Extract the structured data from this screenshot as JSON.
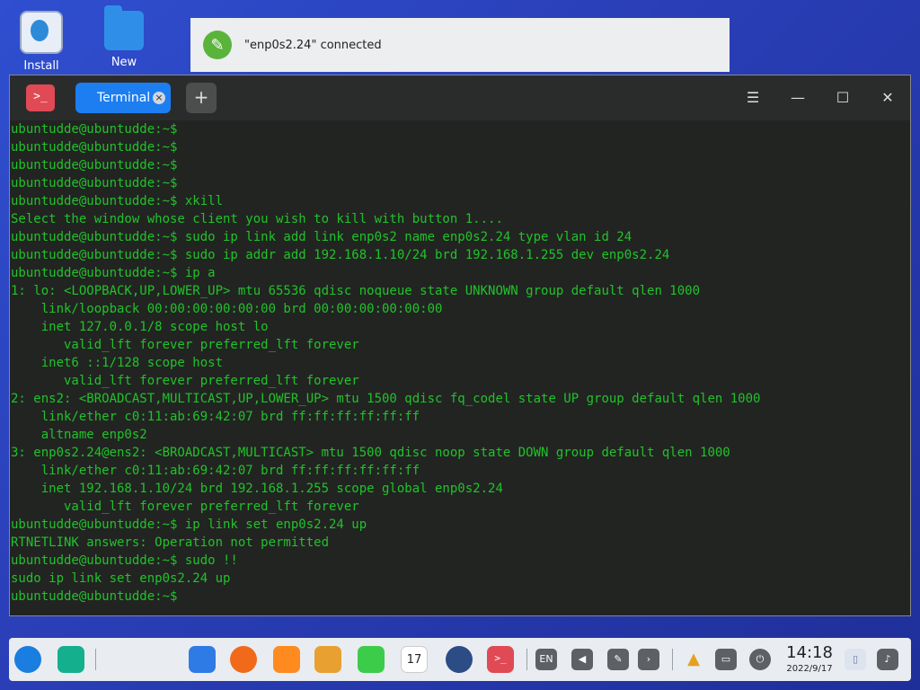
{
  "desktop": {
    "icons": [
      {
        "label": "Install"
      },
      {
        "label": "New"
      }
    ]
  },
  "notification": {
    "text": "\"enp0s2.24\" connected"
  },
  "window": {
    "app_icon": ">_",
    "tab_label": "Terminal",
    "tab_close": "×",
    "new_tab": "+",
    "menu": "☰",
    "minimize": "—",
    "maximize": "☐",
    "close": "✕"
  },
  "terminal": {
    "lines": [
      "ubuntudde@ubuntudde:~$",
      "ubuntudde@ubuntudde:~$",
      "ubuntudde@ubuntudde:~$",
      "ubuntudde@ubuntudde:~$",
      "ubuntudde@ubuntudde:~$ xkill",
      "Select the window whose client you wish to kill with button 1....",
      "ubuntudde@ubuntudde:~$ sudo ip link add link enp0s2 name enp0s2.24 type vlan id 24",
      "ubuntudde@ubuntudde:~$ sudo ip addr add 192.168.1.10/24 brd 192.168.1.255 dev enp0s2.24",
      "ubuntudde@ubuntudde:~$ ip a",
      "1: lo: <LOOPBACK,UP,LOWER_UP> mtu 65536 qdisc noqueue state UNKNOWN group default qlen 1000",
      "    link/loopback 00:00:00:00:00:00 brd 00:00:00:00:00:00",
      "    inet 127.0.0.1/8 scope host lo",
      "       valid_lft forever preferred_lft forever",
      "    inet6 ::1/128 scope host",
      "       valid_lft forever preferred_lft forever",
      "2: ens2: <BROADCAST,MULTICAST,UP,LOWER_UP> mtu 1500 qdisc fq_codel state UP group default qlen 1000",
      "    link/ether c0:11:ab:69:42:07 brd ff:ff:ff:ff:ff:ff",
      "    altname enp0s2",
      "3: enp0s2.24@ens2: <BROADCAST,MULTICAST> mtu 1500 qdisc noop state DOWN group default qlen 1000",
      "    link/ether c0:11:ab:69:42:07 brd ff:ff:ff:ff:ff:ff",
      "    inet 192.168.1.10/24 brd 192.168.1.255 scope global enp0s2.24",
      "       valid_lft forever preferred_lft forever",
      "ubuntudde@ubuntudde:~$ ip link set enp0s2.24 up",
      "RTNETLINK answers: Operation not permitted",
      "ubuntudde@ubuntudde:~$ sudo !!",
      "sudo ip link set enp0s2.24 up",
      "ubuntudde@ubuntudde:~$"
    ]
  },
  "taskbar": {
    "calendar_day": "17",
    "terminal_glyph": ">_",
    "keyboard_label": "EN",
    "clock_time": "14:18",
    "clock_date": "2022/9/17"
  }
}
